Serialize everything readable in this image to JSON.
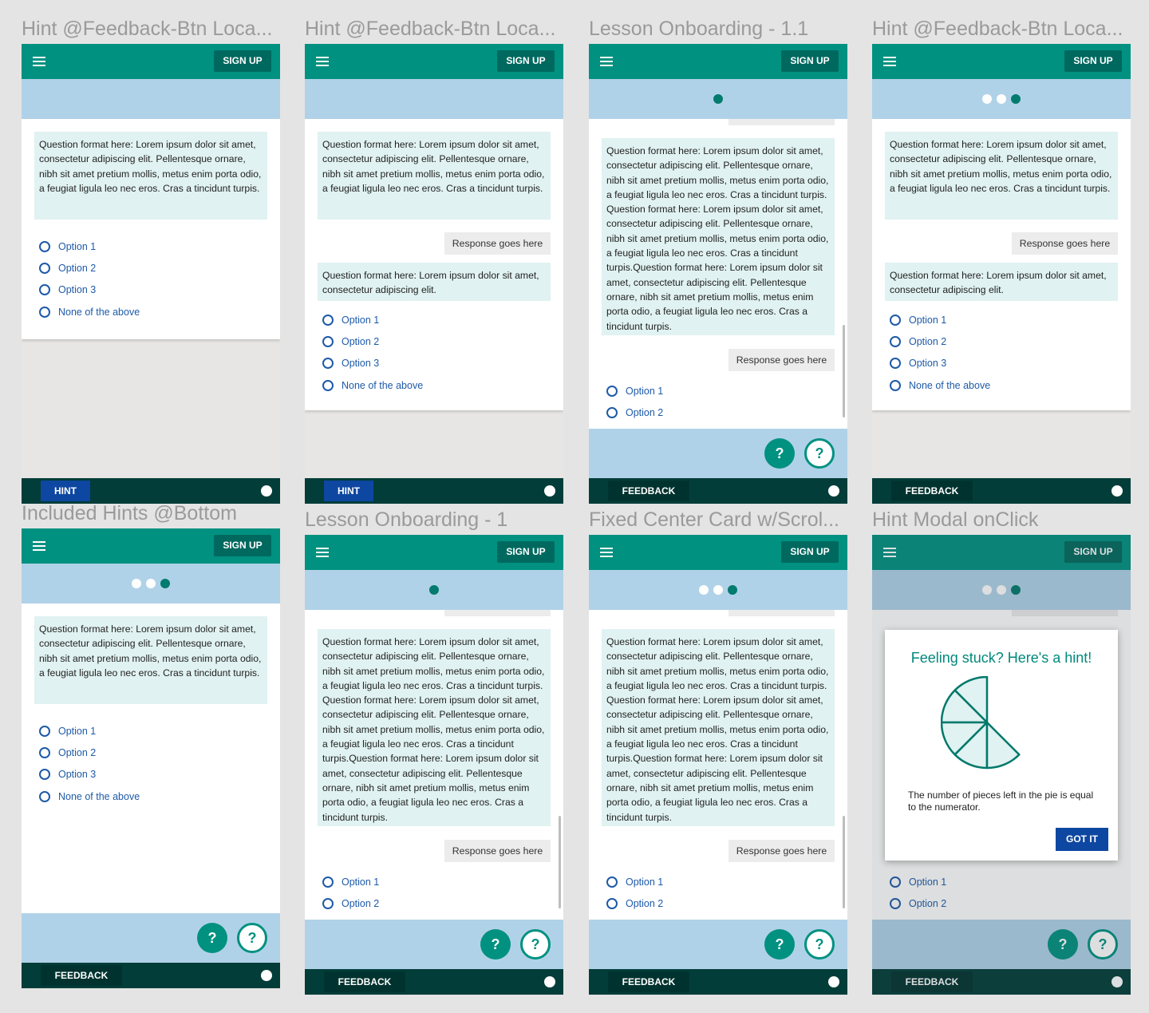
{
  "frames": [
    {
      "title": "Hint @Feedback-Btn Loca..."
    },
    {
      "title": "Hint @Feedback-Btn Loca..."
    },
    {
      "title": "Lesson Onboarding - 1.1"
    },
    {
      "title": "Hint @Feedback-Btn Loca..."
    },
    {
      "title": "Included Hints @Bottom"
    },
    {
      "title": "Lesson Onboarding - 1"
    },
    {
      "title": "Fixed Center Card w/Scrol..."
    },
    {
      "title": "Hint Modal onClick"
    }
  ],
  "appbar": {
    "signup_label": "SIGN UP",
    "menu_icon": "hamburger-menu-icon"
  },
  "question": {
    "short": "Question format here: Lorem ipsum dolor sit amet, consectetur adipiscing elit. Pellentesque ornare, nibh sit amet pretium mollis, metus enim porta odio, a feugiat ligula leo nec eros. Cras a tincidunt turpis.",
    "tiny": "Question format here: Lorem ipsum dolor sit amet, consectetur adipiscing elit.",
    "long": "Question format here: Lorem ipsum dolor sit amet, consectetur adipiscing elit. Pellentesque ornare, nibh sit amet pretium mollis, metus enim porta odio, a feugiat ligula leo nec eros. Cras a tincidunt turpis. Question format here: Lorem ipsum dolor sit amet, consectetur adipiscing elit. Pellentesque ornare, nibh sit amet pretium mollis, metus enim porta odio, a feugiat ligula leo nec eros. Cras a tincidunt turpis.Question format here: Lorem ipsum dolor sit amet, consectetur adipiscing elit. Pellentesque ornare, nibh sit amet pretium mollis, metus enim porta odio, a feugiat ligula leo nec eros. Cras a tincidunt turpis."
  },
  "response_label": "Response goes here",
  "options": [
    "Option 1",
    "Option 2",
    "Option 3",
    "None of the above"
  ],
  "buttons": {
    "hint": "HINT",
    "feedback": "FEEDBACK",
    "fab_label": "?"
  },
  "modal": {
    "title": "Feeling stuck? Here's a hint!",
    "text": "The number of pieces left in the pie is equal to the numerator.",
    "got_it": "GOT IT",
    "pie_total_slices": 8,
    "pie_remaining_slices": 5
  },
  "colors": {
    "primary": "#009180",
    "dark": "#023d39",
    "accent_blue": "#0d47a1",
    "progress_bg": "#b0d2e8",
    "question_bg": "#e0f2f1"
  }
}
